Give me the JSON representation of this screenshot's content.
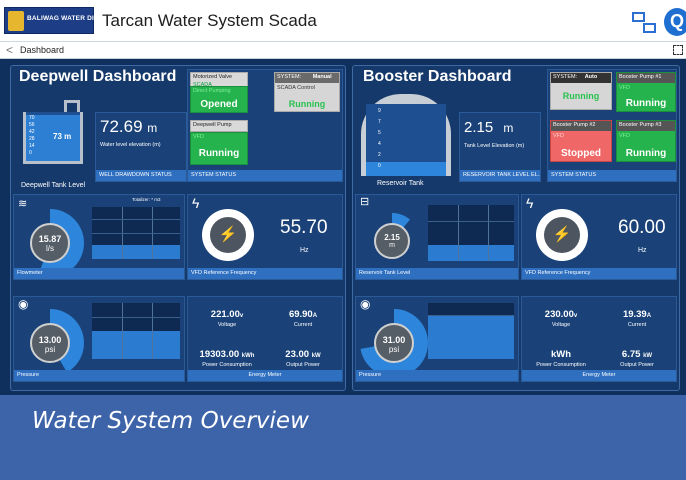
{
  "header": {
    "logo_text": "BALIWAG WATER DISTRICT",
    "app_title": "Tarcan Water System Scada",
    "search_glyph": "Q"
  },
  "nav": {
    "breadcrumb": "Dashboard"
  },
  "deepwell": {
    "title": "Deepwell Dashboard",
    "tank_label": "Deepwell Tank Level",
    "tank_scale": [
      "70",
      "56",
      "42",
      "28",
      "14",
      "0"
    ],
    "tank_reading": "73 m",
    "water_level_value": "72.69",
    "water_level_unit": "m",
    "water_level_caption": "Water level elevation (m)",
    "drawdown_label": "WELL DRAWDOWN STATUS",
    "system_status_label": "SYSTEM STATUS",
    "motorized_valve": {
      "title": "Motorized Valve",
      "line1": "SCADA",
      "line2": "Direct Pumping",
      "value": "Opened"
    },
    "system": {
      "title": "SYSTEM:",
      "mode": "Manual",
      "line1": "SCADA Control",
      "value": "Running"
    },
    "deepwell_pump": {
      "title": "Deepwell Pump",
      "line1": "VFD",
      "value": "Running"
    },
    "flowmeter": {
      "value": "15.87",
      "unit": "l/s",
      "label": "Flowmeter",
      "totalizer": "Totalizer: * m3"
    },
    "vfd": {
      "value": "55.70",
      "unit": "Hz",
      "label": "VFD Reference Frequency"
    },
    "pressure": {
      "value": "13.00",
      "unit": "psi",
      "label": "Pressure"
    },
    "energy": {
      "label": "Energy Meter",
      "voltage": {
        "value": "221.00",
        "unit": "v",
        "label": "Voltage"
      },
      "current": {
        "value": "69.90",
        "unit": "A",
        "label": "Current"
      },
      "power_consumption": {
        "value": "19303.00",
        "unit": "kWh",
        "label": "Power Consumption"
      },
      "output_power": {
        "value": "23.00",
        "unit": "kW",
        "label": "Output Power"
      }
    }
  },
  "booster": {
    "title": "Booster Dashboard",
    "tank_label": "Reservoir Tank",
    "tank_scale": [
      "9",
      "7",
      "5",
      "4",
      "2",
      "0"
    ],
    "level_value": "2.15",
    "level_unit": "m",
    "level_caption": "Tank Level Elevation (m)",
    "reservoir_label": "RESERVOIR TANK LEVEL EL...",
    "system_status_label": "SYSTEM STATUS",
    "system": {
      "title": "SYSTEM:",
      "mode": "Auto",
      "value": "Running"
    },
    "pump1": {
      "title": "Booster Pump #1",
      "line1": "VFD",
      "value": "Running"
    },
    "pump2": {
      "title": "Booster Pump #2",
      "line1": "VFD",
      "value": "Stopped"
    },
    "pump3": {
      "title": "Booster Pump #3",
      "line1": "VFD",
      "value": "Running"
    },
    "reservoir_gauge": {
      "value": "2.15",
      "unit": "m",
      "label": "Reservoir Tank Level"
    },
    "vfd": {
      "value": "60.00",
      "unit": "Hz",
      "label": "VFD Reference Frequency"
    },
    "pressure": {
      "value": "31.00",
      "unit": "psi",
      "label": "Pressure"
    },
    "energy": {
      "label": "Energy Meter",
      "voltage": {
        "value": "230.00",
        "unit": "v",
        "label": "Voltage"
      },
      "current": {
        "value": "19.39",
        "unit": "A",
        "label": "Current"
      },
      "power_consumption": {
        "value": "",
        "unit": "kWh",
        "label": "Power Consumption"
      },
      "output_power": {
        "value": "6.75",
        "unit": "kW",
        "label": "Output Power"
      }
    }
  },
  "footer": {
    "caption": "Water System Overview"
  },
  "colors": {
    "running_green": "#25b34d",
    "stopped_red": "#f06767",
    "accent_blue": "#2e6fc0",
    "panel_bg": "#16396b"
  }
}
